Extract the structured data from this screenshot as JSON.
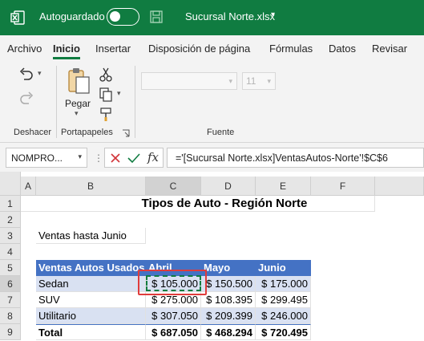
{
  "titlebar": {
    "autosave_label": "Autoguardado",
    "filename": "Sucursal Norte.xlsx",
    "caret": "▾"
  },
  "menu": {
    "tabs": [
      "Archivo",
      "Inicio",
      "Insertar",
      "Disposición de página",
      "Fórmulas",
      "Datos",
      "Revisar"
    ],
    "active": "Inicio"
  },
  "ribbon": {
    "groups": [
      "Deshacer",
      "Portapapeles",
      "Fuente"
    ],
    "paste_label": "Pegar",
    "font_size": "11"
  },
  "formula_bar": {
    "name_box": "NOMPRO...",
    "fx": "fx",
    "formula": "='[Sucursal Norte.xlsx]VentasAutos-Norte'!$C$6"
  },
  "sheet": {
    "columns": [
      "A",
      "B",
      "C",
      "D",
      "E",
      "F"
    ],
    "rows": [
      "1",
      "2",
      "3",
      "4",
      "5",
      "6",
      "7",
      "8",
      "9"
    ],
    "title": "Tipos de Auto - Región Norte",
    "subtitle": "Ventas hasta Junio",
    "table": {
      "headers": [
        "Ventas Autos Usados",
        "Abril",
        "Mayo",
        "Junio"
      ],
      "rows": [
        [
          "Sedan",
          "$ 105.000",
          "$ 150.500",
          "$ 175.000"
        ],
        [
          "SUV",
          "$ 275.000",
          "$ 108.395",
          "$ 299.495"
        ],
        [
          "Utilitario",
          "$ 307.050",
          "$ 209.399",
          "$ 246.000"
        ],
        [
          "Total",
          "$ 687.050",
          "$ 468.294",
          "$ 720.495"
        ]
      ]
    },
    "active_cell": "C6",
    "colors": {
      "header_fill": "#4472c4",
      "band_fill": "#d9e1f2",
      "brand": "#107c41",
      "highlight": "#e03c3c"
    }
  }
}
